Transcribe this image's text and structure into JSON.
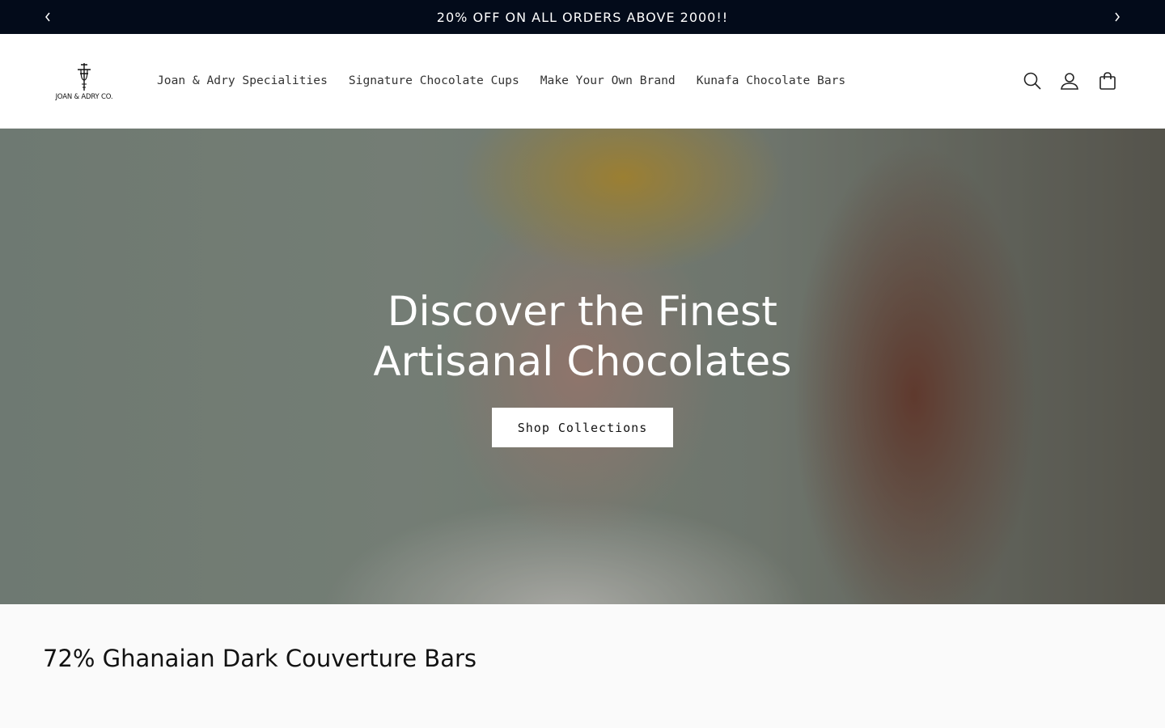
{
  "announcement": {
    "text": "20% OFF ON ALL ORDERS ABOVE 2000!!",
    "prev_icon": "chevron-left-icon",
    "next_icon": "chevron-right-icon",
    "background": "#030b1a"
  },
  "header": {
    "logo_text": "JOAN & ADRY CO.",
    "nav": [
      {
        "label": "Joan & Adry Specialities"
      },
      {
        "label": "Signature Chocolate Cups"
      },
      {
        "label": "Make Your Own Brand"
      },
      {
        "label": "Kunafa Chocolate Bars"
      }
    ],
    "icons": [
      "search-icon",
      "account-icon",
      "cart-icon"
    ]
  },
  "hero": {
    "title": "Discover the Finest Artisanal Chocolates",
    "button_label": "Shop Collections"
  },
  "section": {
    "title": "72% Ghanaian Dark Couverture Bars"
  }
}
